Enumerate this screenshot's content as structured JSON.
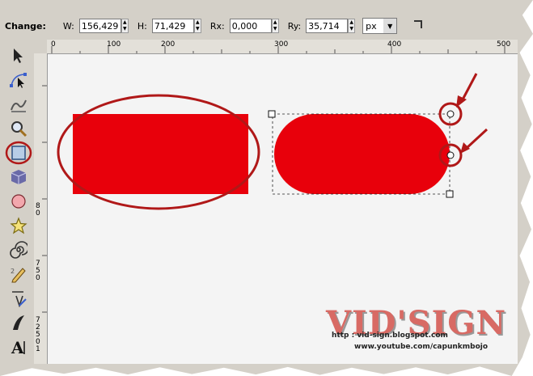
{
  "toolbar": {
    "change_label": "Change:",
    "w_label": "W:",
    "w_value": "156,429",
    "h_label": "H:",
    "h_value": "71,429",
    "rx_label": "Rx:",
    "rx_value": "0,000",
    "ry_label": "Ry:",
    "ry_value": "35,714",
    "unit": "px",
    "icons": [
      "spin-arrows-icon",
      "dropdown-arrow-icon",
      "rect-corner-icon"
    ]
  },
  "ruler": {
    "horizontal": [
      "0",
      "100",
      "200",
      "300",
      "400",
      "500"
    ],
    "vertical": [
      "8",
      "0",
      "7",
      "5",
      "0",
      "7",
      "2",
      "5",
      "0",
      "1"
    ]
  },
  "tools": [
    "selector-tool-icon",
    "node-tool-icon",
    "tweak-tool-icon",
    "zoom-tool-icon",
    "rectangle-tool-icon",
    "3d-box-tool-icon",
    "ellipse-tool-icon",
    "star-tool-icon",
    "spiral-tool-icon",
    "pencil-tool-icon",
    "pen-tool-icon",
    "calligraphy-tool-icon",
    "text-tool-icon"
  ],
  "colors": {
    "shape_fill": "#e8000b",
    "highlight_ring": "#b01818",
    "toolbar_bg": "#d4d0c8",
    "canvas_bg": "#f4f4f4"
  },
  "watermark": {
    "title": "VID'SIGN",
    "url1": "http : vid-sign.blogspot.com",
    "url2": "www.youtube.com/capunkmbojo"
  }
}
